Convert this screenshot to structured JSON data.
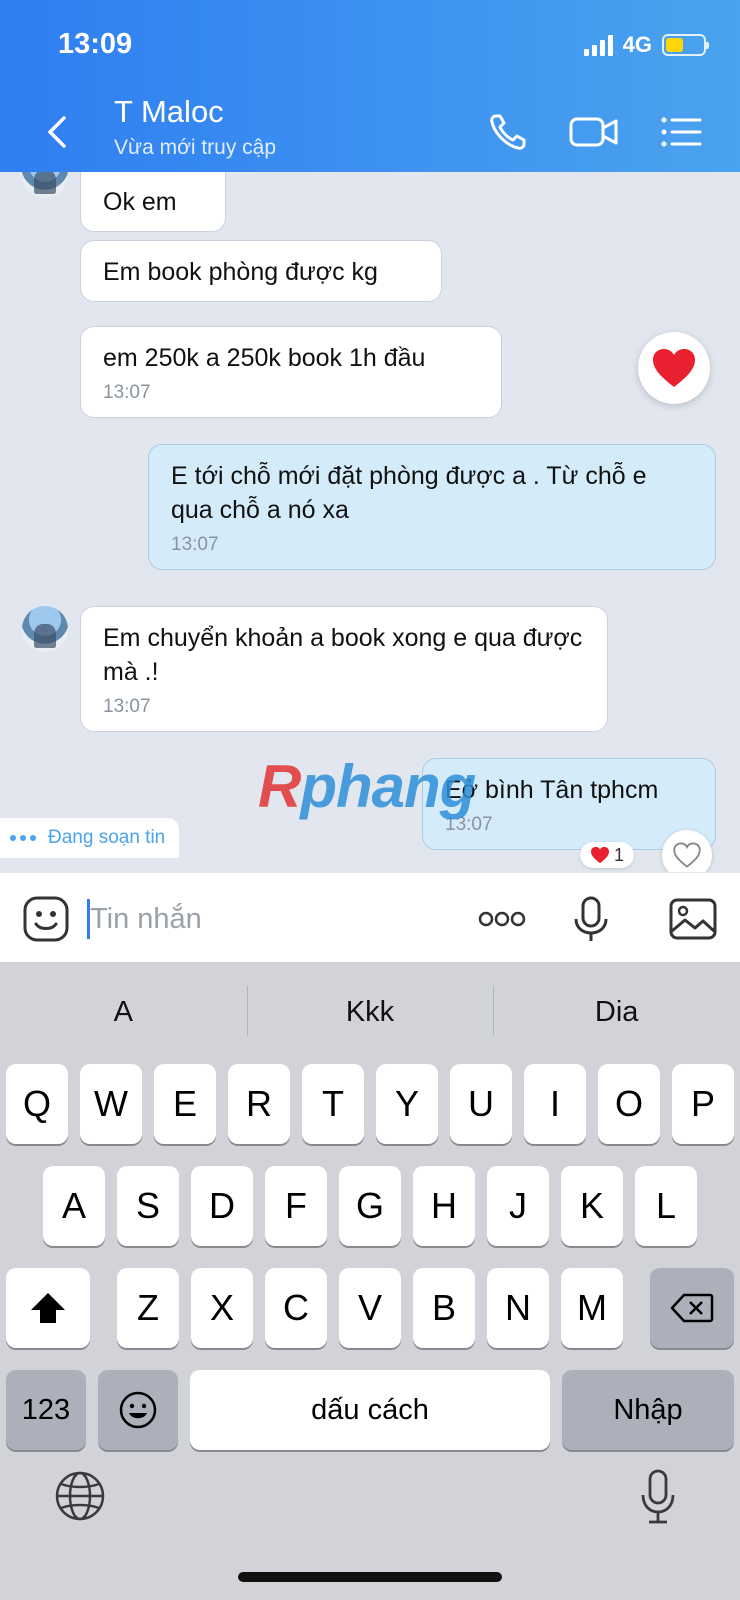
{
  "status_bar": {
    "time": "13:09",
    "network": "4G"
  },
  "header": {
    "contact_name": "T Maloc",
    "contact_status": "Vừa mới truy cập",
    "icons": [
      "back-icon",
      "phone-icon",
      "video-call-icon",
      "menu-list-icon"
    ]
  },
  "messages": [
    {
      "direction": "in",
      "text": "Ok em",
      "time": ""
    },
    {
      "direction": "in",
      "text": "Em book phòng được kg",
      "time": ""
    },
    {
      "direction": "in",
      "text": "em 250k a 250k book 1h đầu",
      "time": "13:07",
      "reaction": "heart"
    },
    {
      "direction": "out",
      "text": "E tới chỗ mới đặt phòng được a . Từ chỗ e qua chỗ a nó xa",
      "time": "13:07"
    },
    {
      "direction": "in",
      "text": "Em chuyển khoản a book xong e qua được mà .!",
      "time": "13:07"
    },
    {
      "direction": "out",
      "text": "Eở bình Tân tphcm",
      "time": "13:07",
      "reaction_count": "1"
    }
  ],
  "typing_indicator": "Đang soạn tin",
  "watermark": {
    "part1": "R",
    "part2": "phang"
  },
  "composer": {
    "placeholder": "Tin nhắn",
    "value": ""
  },
  "keyboard": {
    "suggestions": [
      "A",
      "Kkk",
      "Dia"
    ],
    "row1": [
      "Q",
      "W",
      "E",
      "R",
      "T",
      "Y",
      "U",
      "I",
      "O",
      "P"
    ],
    "row2": [
      "A",
      "S",
      "D",
      "F",
      "G",
      "H",
      "J",
      "K",
      "L"
    ],
    "row3": [
      "Z",
      "X",
      "C",
      "V",
      "B",
      "N",
      "M"
    ],
    "numbers_key": "123",
    "space_key": "dấu cách",
    "return_key": "Nhập"
  },
  "colors": {
    "header_start": "#2f7ef2",
    "header_end": "#4aa3ee",
    "outgoing_bubble": "#d4ebfa",
    "incoming_bubble": "#ffffff",
    "heart": "#e8202f"
  }
}
